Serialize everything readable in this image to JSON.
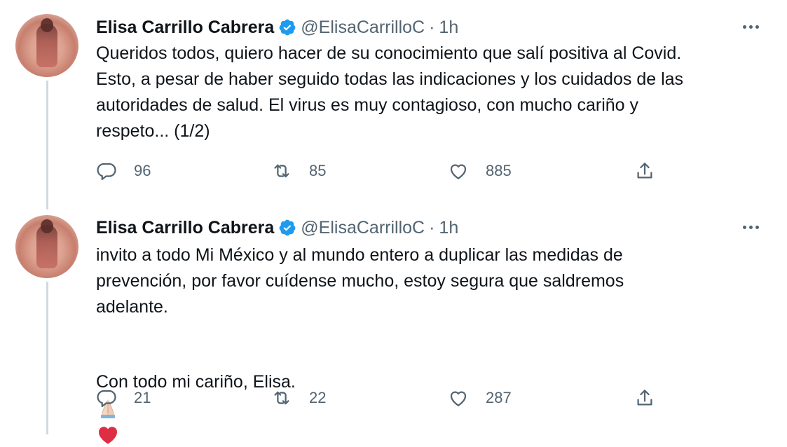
{
  "tweets": [
    {
      "name": "Elisa Carrillo Cabrera",
      "handle": "@ElisaCarrilloC",
      "separator": "·",
      "time": "1h",
      "text": "Queridos todos, quiero hacer de su conocimiento que salí positiva al Covid.\nEsto, a pesar de haber seguido todas las indicaciones y los cuidados de las\nautoridades de salud.  El virus es muy contagioso, con mucho cariño y\nrespeto... (1/2)",
      "reply_count": "96",
      "retweet_count": "85",
      "like_count": "885"
    },
    {
      "name": "Elisa Carrillo Cabrera",
      "handle": "@ElisaCarrilloC",
      "separator": "·",
      "time": "1h",
      "text": "invito a todo Mi México y al  mundo entero a duplicar las medidas de\nprevención, por favor cuídense mucho, estoy segura que saldremos\nadelante.",
      "text2": "Con todo mi  cariño, Elisa.",
      "reply_count": "21",
      "retweet_count": "22",
      "like_count": "287"
    }
  ],
  "icons": {
    "verified": "verified-badge-icon",
    "more": "more-options-icon",
    "reply": "reply-icon",
    "retweet": "retweet-icon",
    "like": "like-icon",
    "share": "share-icon",
    "emoji1": "folded-hands-emoji",
    "emoji2": "red-heart-emoji"
  },
  "colors": {
    "text": "#0f1419",
    "secondary": "#536471",
    "verified": "#1d9bf0",
    "thread_line": "#cfd9de",
    "heart": "#dd2e44"
  }
}
